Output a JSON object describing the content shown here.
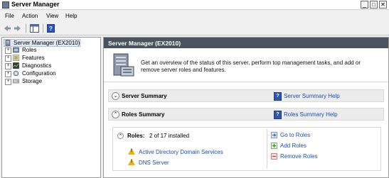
{
  "window": {
    "title": "Server Manager"
  },
  "menu": {
    "file": "File",
    "action": "Action",
    "view": "View",
    "help": "Help"
  },
  "tree": {
    "root": "Server Manager (EX2010)",
    "items": [
      {
        "label": "Roles"
      },
      {
        "label": "Features"
      },
      {
        "label": "Diagnostics"
      },
      {
        "label": "Configuration"
      },
      {
        "label": "Storage"
      }
    ]
  },
  "content": {
    "header": "Server Manager (EX2010)",
    "overview": "Get an overview of the status of this server, perform top management tasks, and add or remove server roles and features.",
    "server_summary": {
      "title": "Server Summary",
      "help": "Server Summary Help"
    },
    "roles_summary": {
      "title": "Roles Summary",
      "help": "Roles Summary Help",
      "roles_label": "Roles:",
      "roles_count": "2 of 17 installed",
      "installed": [
        "Active Directory Domain Services",
        "DNS Server"
      ],
      "actions": [
        "Go to Roles",
        "Add Roles",
        "Remove Roles"
      ]
    }
  },
  "colors": {
    "header_bg": "#4a5360",
    "link": "#1a4fb8",
    "warning": "#e8b600"
  }
}
